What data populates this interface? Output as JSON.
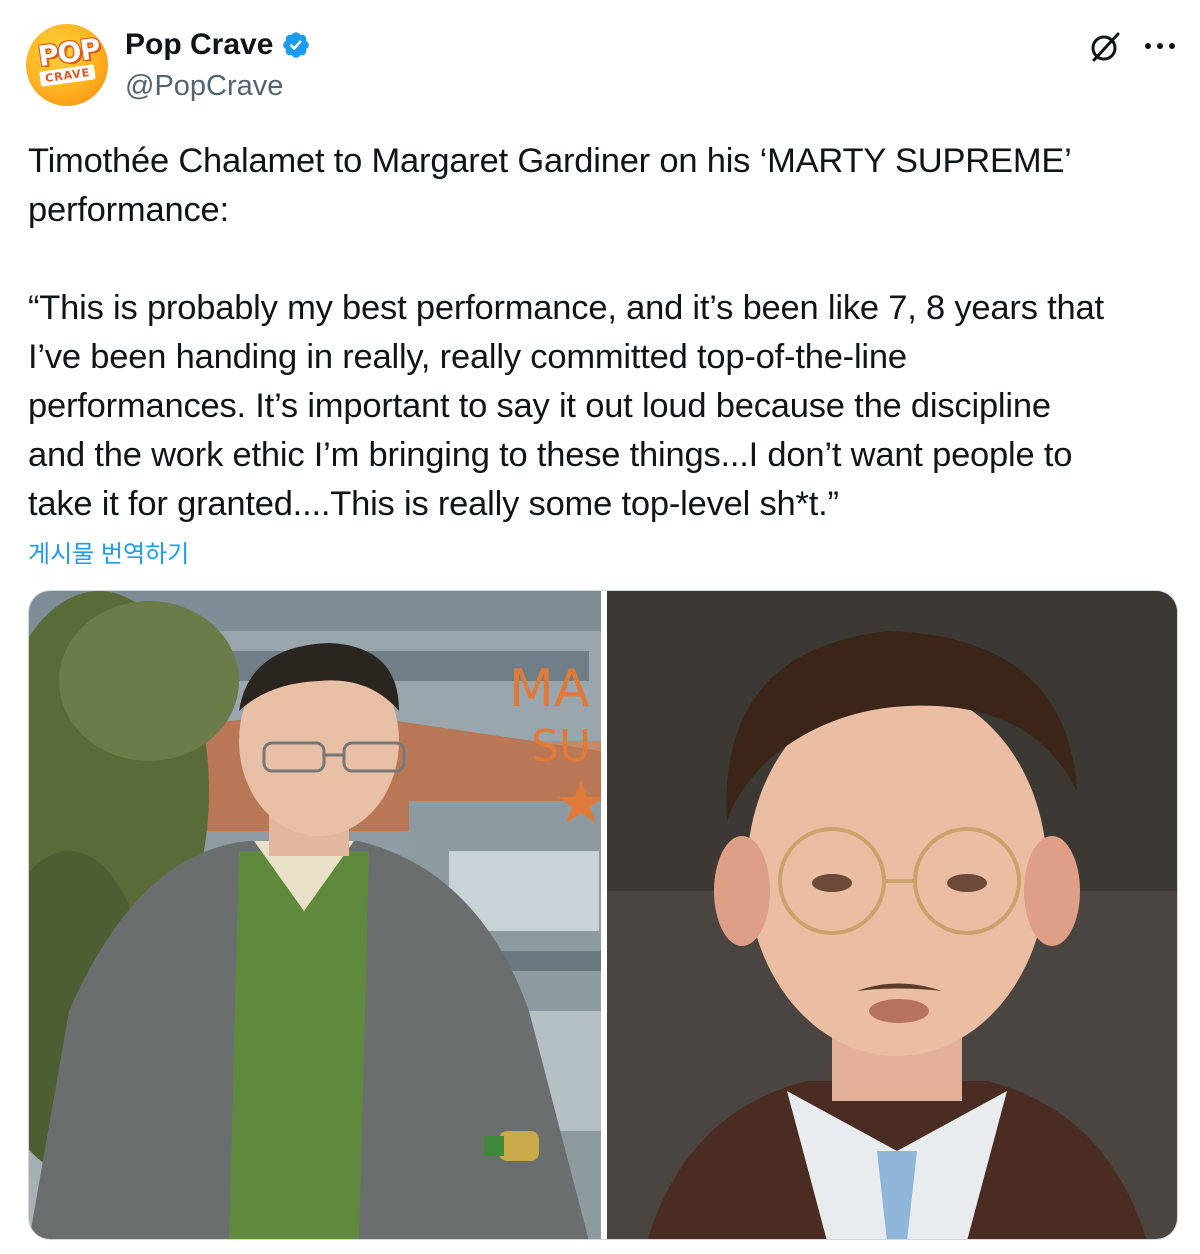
{
  "author": {
    "name": "Pop Crave",
    "handle": "@PopCrave",
    "verified": true,
    "avatar_text_top": "POP",
    "avatar_text_bottom": "CRAVE",
    "avatar_icon": "pop-crave-logo"
  },
  "header_actions": {
    "grok_icon": "grok-icon",
    "more_icon": "more-dots-icon"
  },
  "tweet": {
    "text": "Timothée Chalamet to Margaret Gardiner on his ‘MARTY SUPREME’\nperformance:\n\n“This is probably my best performance, and it’s been like 7, 8 years that\nI’ve been handing in really, really committed top-of-the-line\nperformances. It’s important to say it out loud because the discipline\nand the work ethic I’m bringing to these things...I don’t want people to\ntake it for granted....This is really some top-level sh*t.”",
    "translate_label": "게시물 번역하기"
  },
  "media": {
    "left_backdrop_text_line1": "MA",
    "left_backdrop_text_line2": "SU"
  },
  "colors": {
    "text": "#0f1419",
    "secondary": "#536471",
    "link": "#1d9bf0",
    "verified": "#1d9bf0",
    "border": "#cfd9de"
  }
}
